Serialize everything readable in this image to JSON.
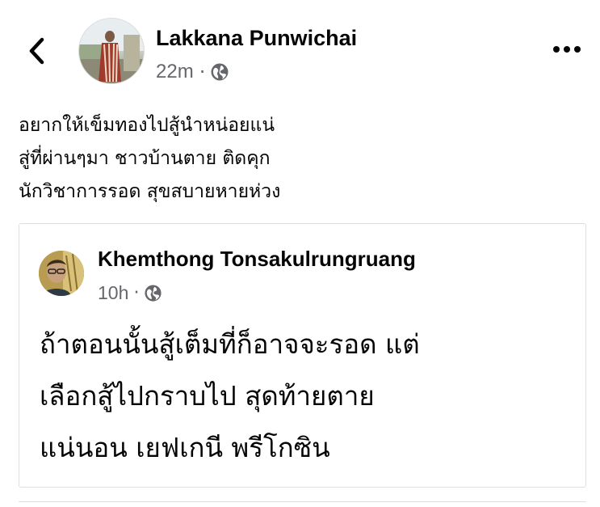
{
  "header": {
    "back_icon": "chevron-left-icon",
    "author_name": "Lakkana Punwichai",
    "timestamp": "22m",
    "separator": "·",
    "privacy_icon": "globe-icon",
    "more_icon": "more-horizontal-icon"
  },
  "post": {
    "lines": [
      "อยากให้เข็มทองไปสู้นำหน่อยแน่",
      "สู่ที่ผ่านๆมา ชาวบ้านตาย ติดคุก",
      "นักวิชาการรอด สุขสบายหายห่วง"
    ]
  },
  "shared_post": {
    "author_name": "Khemthong Tonsakulrungruang",
    "timestamp": "10h",
    "separator": "·",
    "privacy_icon": "globe-icon",
    "lines": [
      "ถ้าตอนนั้นสู้เต็มที่ก็อาจจะรอด แต่",
      "เลือกสู้ไปกราบไป สุดท้ายตาย",
      "แน่นอน เยฟเกนี พรีโกซิน"
    ]
  },
  "colors": {
    "text_primary": "#050505",
    "text_secondary": "#65676b",
    "border": "#dddfe2",
    "background": "#ffffff"
  }
}
